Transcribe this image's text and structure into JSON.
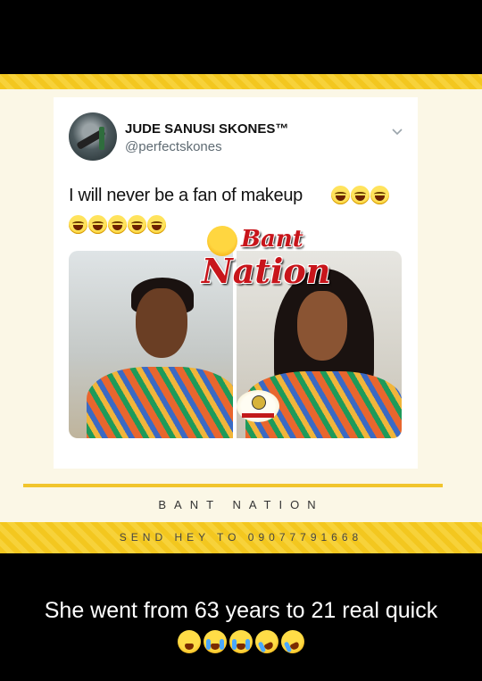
{
  "tweet": {
    "author_name": "JUDE SANUSI SKONES™",
    "handle": "@perfectskones",
    "text": "I will never be a fan of makeup",
    "emoji_line1_count": 3,
    "emoji_line2_count": 5
  },
  "watermark": {
    "logo_line1": "Bant",
    "logo_line2": "Nation",
    "eye_logo_text": "SBL"
  },
  "footer": {
    "brand": "BANT NATION",
    "send_hey": "SEND HEY TO 09077791668"
  },
  "caption": {
    "text": "She went from 63 years to 21 real quick",
    "emojis": [
      "tired-face-emoji",
      "crying-face-emoji",
      "crying-face-emoji",
      "rolling-laughing-emoji",
      "rolling-laughing-emoji"
    ]
  },
  "colors": {
    "band_yellow": "#f3c71f",
    "brand_red": "#c8151b",
    "background": "#000000"
  }
}
